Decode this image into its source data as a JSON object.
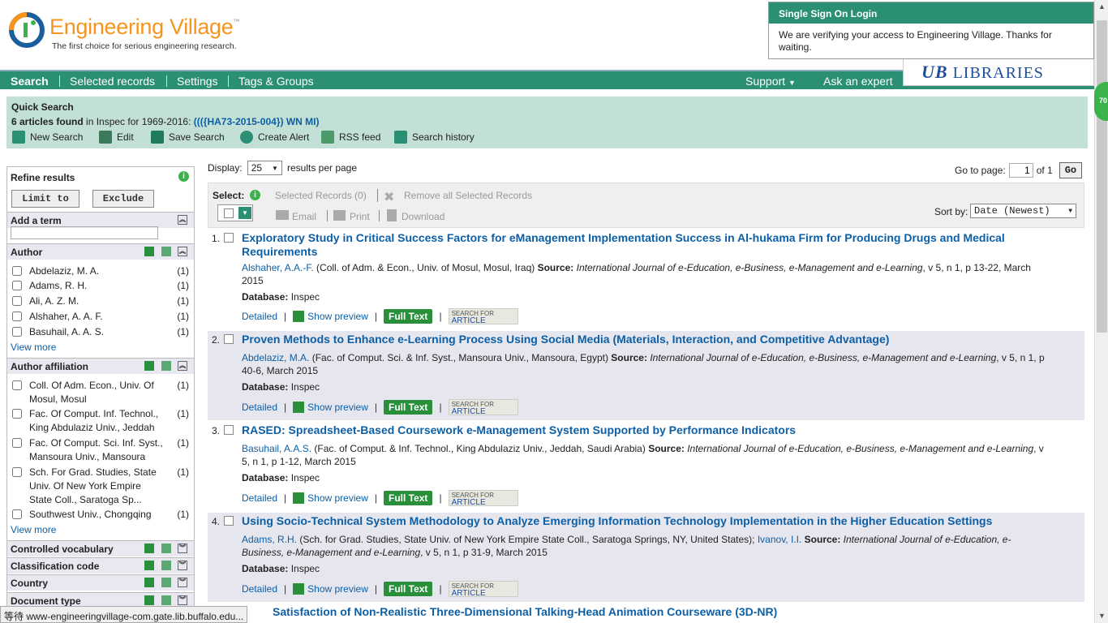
{
  "header": {
    "logo_name": "Engineering Village",
    "logo_tm": "™",
    "tagline": "The first choice for serious engineering research."
  },
  "sso": {
    "title": "Single Sign On Login",
    "message": "We are verifying your access to Engineering Village. Thanks for waiting."
  },
  "ub_logo": {
    "mark": "UB",
    "text": "LIBRARIES"
  },
  "nav": {
    "items": [
      "Search",
      "Selected records",
      "Settings",
      "Tags & Groups"
    ],
    "support": "Support",
    "ask": "Ask an expert"
  },
  "quick_search": {
    "title": "Quick Search",
    "count_text": "6 articles found",
    "in_text": " in Inspec for 1969-2016: ",
    "query": "((({HA73-2015-004}) WN MI)",
    "tools": [
      "New Search",
      "Edit",
      "Save Search",
      "Create Alert",
      "RSS feed",
      "Search history"
    ]
  },
  "sidebar": {
    "title": "Refine results",
    "limit": "Limit to",
    "exclude": "Exclude",
    "add_term": "Add a term",
    "author": {
      "title": "Author",
      "items": [
        {
          "label": "Abdelaziz, M. A.",
          "count": "(1)"
        },
        {
          "label": "Adams, R. H.",
          "count": "(1)"
        },
        {
          "label": "Ali, A. Z. M.",
          "count": "(1)"
        },
        {
          "label": "Alshaher, A. A. F.",
          "count": "(1)"
        },
        {
          "label": "Basuhail, A. A. S.",
          "count": "(1)"
        }
      ],
      "more": "View more"
    },
    "affiliation": {
      "title": "Author affiliation",
      "items": [
        {
          "label": "Coll. Of Adm. Econ., Univ. Of Mosul, Mosul",
          "count": "(1)"
        },
        {
          "label": "Fac. Of Comput. Inf. Technol., King Abdulaziz Univ., Jeddah",
          "count": "(1)"
        },
        {
          "label": "Fac. Of Comput. Sci. Inf. Syst., Mansoura Univ., Mansoura",
          "count": "(1)"
        },
        {
          "label": "Sch. For Grad. Studies, State Univ. Of New York Empire State Coll., Saratoga Sp...",
          "count": "(1)"
        },
        {
          "label": "Southwest Univ., Chongqing",
          "count": "(1)"
        }
      ],
      "more": "View more"
    },
    "collapsed": [
      "Controlled vocabulary",
      "Classification code",
      "Country",
      "Document type"
    ]
  },
  "results_controls": {
    "display_label": "Display:",
    "display_value": "25",
    "per_page": "results per page",
    "goto_label": "Go to page:",
    "page": "1",
    "of": "of 1",
    "go": "Go",
    "select": "Select:",
    "selected_records": "Selected Records (0)",
    "remove_all": "Remove all Selected Records",
    "email": "Email",
    "print": "Print",
    "download": "Download",
    "sort_label": "Sort by:",
    "sort_value": "Date (Newest)"
  },
  "results": [
    {
      "num": "1.",
      "title": "Exploratory Study in Critical Success Factors for eManagement Implementation Success in Al-hukama Firm for Producing Drugs and Medical Requirements",
      "author": "Alshaher, A.A.-F.",
      "affil": " (Coll. of Adm. & Econ., Univ. of Mosul, Mosul, Iraq)  ",
      "source_label": "Source:",
      "source": " International Journal of e-Education, e-Business, e-Management and e-Learning",
      "source_tail": ", v 5, n 1, p 13-22, March 2015",
      "db_label": "Database:",
      "db": " Inspec"
    },
    {
      "num": "2.",
      "title": "Proven Methods to Enhance e-Learning Process Using Social Media (Materials, Interaction, and Competitive Advantage)",
      "author": "Abdelaziz, M.A.",
      "affil": " (Fac. of Comput. Sci. & Inf. Syst., Mansoura Univ., Mansoura, Egypt)  ",
      "source_label": "Source:",
      "source": " International Journal of e-Education, e-Business, e-Management and e-Learning",
      "source_tail": ", v 5, n 1, p 40-6, March 2015",
      "db_label": "Database:",
      "db": " Inspec"
    },
    {
      "num": "3.",
      "title": "RASED: Spreadsheet-Based Coursework e-Management System Supported by Performance Indicators",
      "author": "Basuhail, A.A.S.",
      "affil": " (Fac. of Comput. & Inf. Technol., King Abdulaziz Univ., Jeddah, Saudi Arabia)  ",
      "source_label": "Source:",
      "source": " International Journal of e-Education, e-Business, e-Management and e-Learning",
      "source_tail": ", v 5, n 1, p 1-12, March 2015",
      "db_label": "Database:",
      "db": " Inspec"
    },
    {
      "num": "4.",
      "title": "Using Socio-Technical System Methodology to Analyze Emerging Information Technology Implementation in the Higher Education Settings",
      "author": "Adams, R.H.",
      "affil": " (Sch. for Grad. Studies, State Univ. of New York Empire State Coll., Saratoga Springs, NY, United States); ",
      "author2": "Ivanov, I.I.",
      "source_label": "Source:",
      "source": " International Journal of e-Education, e-Business, e-Management and e-Learning",
      "source_tail": ", v 5, n 1, p 31-9, March 2015",
      "db_label": "Database:",
      "db": " Inspec"
    }
  ],
  "result5_title": "Satisfaction of Non-Realistic Three-Dimensional Talking-Head Animation Courseware (3D-NR)",
  "links": {
    "detailed": "Detailed",
    "preview": "Show preview",
    "fulltext": "Full Text",
    "sfa_top": "SEARCH FOR",
    "sfa_bottom": "ARTICLE"
  },
  "badge": "70",
  "status": "等待 www-engineeringvillage-com.gate.lib.buffalo.edu..."
}
